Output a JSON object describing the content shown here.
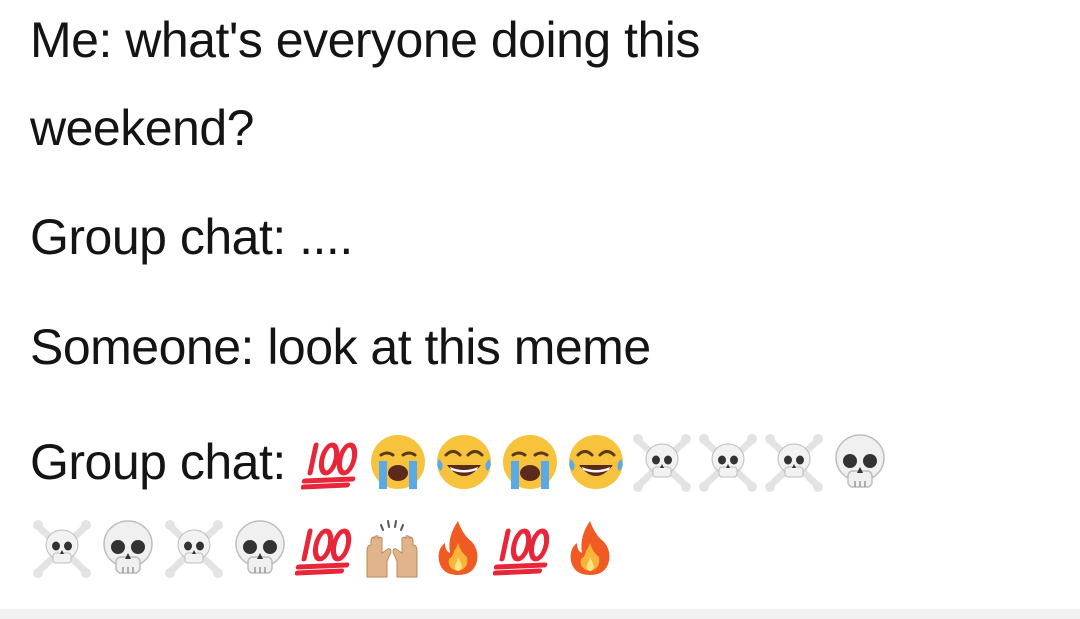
{
  "post": {
    "lines": [
      "Me: what's everyone doing this",
      "weekend?",
      "Group chat: ....",
      "Someone: look at this meme",
      "Group chat:"
    ],
    "reaction_row_1": [
      "hundred-points",
      "loudly-crying",
      "tears-of-joy",
      "loudly-crying",
      "tears-of-joy",
      "skull-and-crossbones",
      "skull-and-crossbones",
      "skull-and-crossbones",
      "skull"
    ],
    "reaction_row_2": [
      "skull-and-crossbones",
      "skull",
      "skull-and-crossbones",
      "skull",
      "hundred-points",
      "raising-hands",
      "fire",
      "hundred-points",
      "fire"
    ]
  },
  "colors": {
    "text": "#141414",
    "hundred": "#e8263a",
    "emoji_face": "#f7c33d",
    "tear": "#5aa9e6",
    "skull": "#e3e3e3",
    "fire": "#f05a23",
    "hands": "#e2b48c"
  }
}
